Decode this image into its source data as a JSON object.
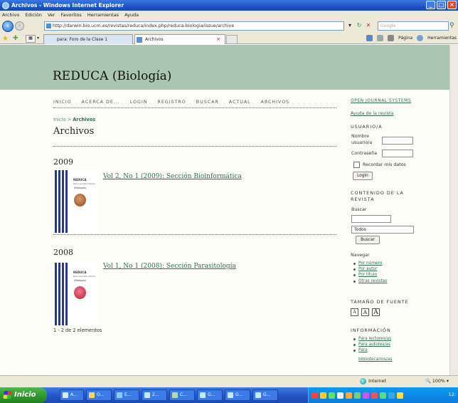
{
  "window": {
    "title": "Archivos - Windows Internet Explorer"
  },
  "menu": [
    "Archivo",
    "Edición",
    "Ver",
    "Favoritos",
    "Herramientas",
    "Ayuda"
  ],
  "address": {
    "url": "http://darwin.bio.ucm.es/revistas/reduca/index.php/reduca-biologia/issue/archive",
    "search_placeholder": "Google"
  },
  "tabs": [
    {
      "label": "para: Foro de la Clase 1"
    },
    {
      "label": "Archivos"
    }
  ],
  "toolbar": {
    "page": "Página",
    "tools": "Herramientas"
  },
  "site": {
    "title": "REDUCA (Biología)",
    "nav": [
      "INICIO",
      "ACERCA DE...",
      "LOGIN",
      "REGISTRO",
      "BUSCAR",
      "ACTUAL",
      "ARCHIVOS"
    ]
  },
  "breadcrumb": {
    "home": "Inicio",
    "sep": ">",
    "current": "Archivos"
  },
  "page_title": "Archivos",
  "issues": [
    {
      "year": "2009",
      "link": "Vol 2, No 1 (2009): Sección Bioinformática",
      "cover_color": "#c47a4a"
    },
    {
      "year": "2008",
      "link": "Vol 1, No 1 (2008): Sección Parasitología",
      "cover_color": "#d8435a"
    }
  ],
  "cover_text": {
    "brand": "REDUCA",
    "sub": "Recursos Educativos",
    "area": "(Biología)"
  },
  "item_count": "1 - 2 de 2 elementos",
  "sidebar": {
    "ojs": "OPEN JOURNAL SYSTEMS",
    "help": "Ayuda de la revista",
    "user_head": "USUARIO/A",
    "username_label_1": "Nombre",
    "username_label_2": "usuario/a",
    "password_label": "Contraseña",
    "remember": "Recordar mis datos",
    "login": "Login",
    "content_head_1": "CONTENIDO DE LA",
    "content_head_2": "REVISTA",
    "search_label": "Buscar",
    "search_scope": "Todos",
    "search_btn": "Buscar",
    "browse_head": "Navegar",
    "browse": [
      "Por número",
      "Por autor",
      "Por título",
      "Otras revistas"
    ],
    "fontsize_head": "TAMAÑO DE FUENTE",
    "fontsizes": [
      "A",
      "A",
      "A"
    ],
    "info_head": "INFORMACIÓN",
    "info": [
      "Para lectores/as",
      "Para autores/as",
      "Para",
      "bibliotecarios/as"
    ]
  },
  "status": {
    "zone": "Internet",
    "zoom": "100%"
  },
  "taskbar": {
    "start": "Inicio",
    "tasks": [
      "A...",
      "O...",
      "E...",
      "2...",
      "C...",
      "G...",
      "G...",
      "G..."
    ],
    "clock": "12:"
  }
}
